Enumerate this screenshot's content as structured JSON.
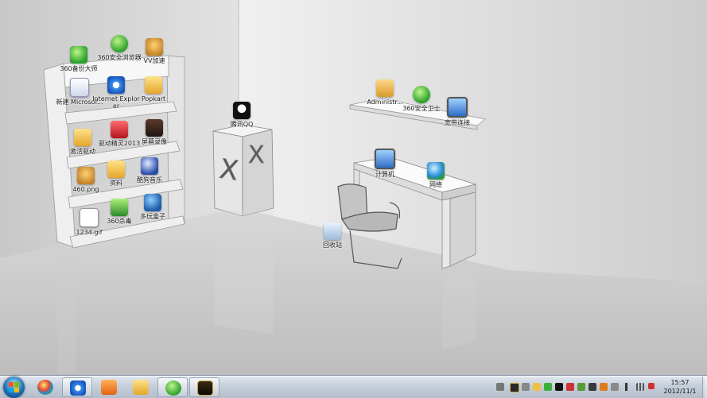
{
  "desktop": {
    "icons": [
      {
        "key": "360safe_big",
        "label": "360备份大师",
        "icon": "shield-green"
      },
      {
        "key": "360browser",
        "label": "360安全浏览器",
        "icon": "browser-green"
      },
      {
        "key": "vv",
        "label": "VV加速",
        "icon": "bear"
      },
      {
        "key": "word",
        "label": "新建 Microsof...",
        "icon": "word-doc"
      },
      {
        "key": "ie",
        "label": "Internet Explorer",
        "icon": "ie"
      },
      {
        "key": "popkart",
        "label": "Popkart",
        "icon": "folder"
      },
      {
        "key": "driver",
        "label": "激活驱动",
        "icon": "folder"
      },
      {
        "key": "drivegenius",
        "label": "驱动精灵2013",
        "icon": "app-red"
      },
      {
        "key": "ram",
        "label": "屏幕录像",
        "icon": "app-dark"
      },
      {
        "key": "img460",
        "label": "460.png",
        "icon": "image"
      },
      {
        "key": "ziliao",
        "label": "资料",
        "icon": "folder"
      },
      {
        "key": "kugou",
        "label": "酷狗音乐",
        "icon": "music"
      },
      {
        "key": "gif1234",
        "label": "1234.gif",
        "icon": "gif"
      },
      {
        "key": "360sd",
        "label": "360杀毒",
        "icon": "shield-green"
      },
      {
        "key": "duowan",
        "label": "多玩盒子",
        "icon": "game"
      },
      {
        "key": "qq",
        "label": "腾讯QQ",
        "icon": "qq"
      },
      {
        "key": "admin",
        "label": "Administr...",
        "icon": "user-folder"
      },
      {
        "key": "360guard",
        "label": "360安全卫士",
        "icon": "guard"
      },
      {
        "key": "network_place",
        "label": "宽带连接",
        "icon": "network"
      },
      {
        "key": "computer",
        "label": "计算机",
        "icon": "computer"
      },
      {
        "key": "network",
        "label": "网络",
        "icon": "globe"
      },
      {
        "key": "recycle",
        "label": "回收站",
        "icon": "recycle-bin"
      }
    ]
  },
  "taskbar": {
    "pinned": [
      {
        "key": "ie",
        "icon": "ie-icon",
        "active": true
      },
      {
        "key": "media",
        "icon": "media-player-icon",
        "active": false
      },
      {
        "key": "explorer",
        "icon": "folder-icon",
        "active": false
      },
      {
        "key": "browser360",
        "icon": "browser360-icon",
        "active": true
      },
      {
        "key": "lol",
        "icon": "league-icon",
        "active": true
      }
    ],
    "clock": {
      "time": "15:57",
      "date": "2012/11/1"
    }
  },
  "colors": {
    "wall": "#d9d9d9",
    "floor": "#cfcfcf",
    "taskbar": "#c5ced9"
  }
}
